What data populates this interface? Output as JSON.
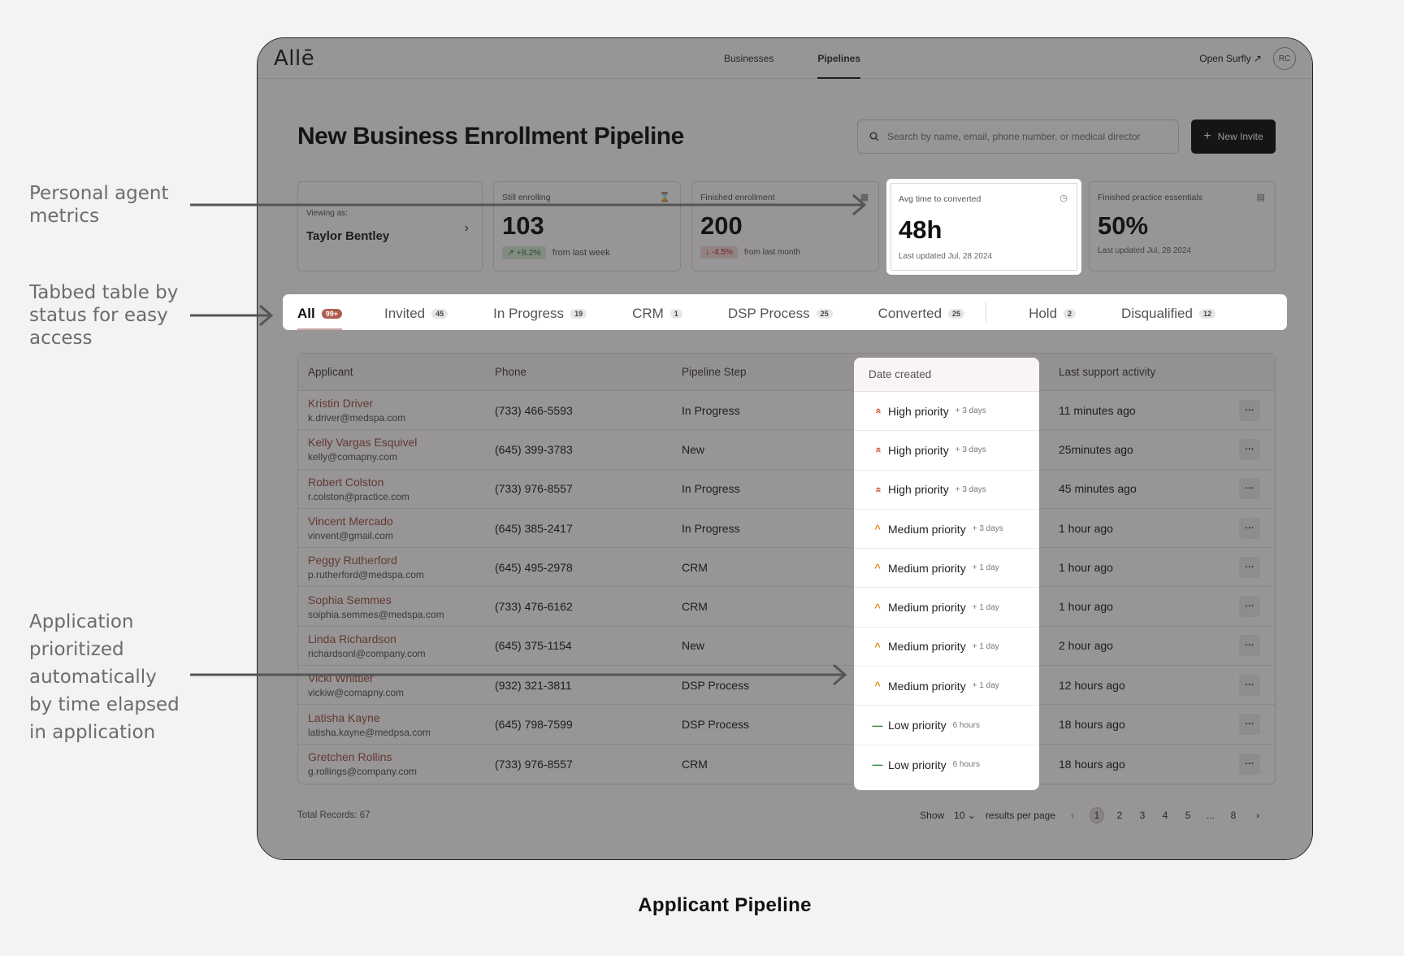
{
  "annotations": {
    "metrics": "Personal agent metrics",
    "tabs": "Tabbed table by status for easy access",
    "priority": "Application prioritized automatically by time elapsed in application"
  },
  "caption": "Applicant Pipeline",
  "app": {
    "logo": "Allē",
    "nav": [
      "Businesses",
      "Pipelines"
    ],
    "active_nav": "Pipelines",
    "open_surfly": "Open Surfly ↗",
    "avatar_initials": "RC"
  },
  "header": {
    "title": "New Business Enrollment Pipeline",
    "search_placeholder": "Search by name, email, phone number, or medical director",
    "new_invite_label": "New Invite"
  },
  "viewing": {
    "label": "Viewing as:",
    "name": "Taylor Bentley"
  },
  "metrics": [
    {
      "label": "Still enrolling",
      "value": "103",
      "change": "↗ +8.2%",
      "change_dir": "up",
      "foot": "from last week",
      "icon": "hourglass-icon"
    },
    {
      "label": "Finished enrollment",
      "value": "200",
      "change": "↓ -4.5%",
      "change_dir": "down",
      "foot": "from last month",
      "icon": "calendar-icon"
    },
    {
      "label": "Avg time to converted",
      "value": "48h",
      "foot": "Last updated Jul, 28 2024",
      "icon": "clock-icon"
    },
    {
      "label": "Finished practice essentials",
      "value": "50%",
      "foot": "Last updated Jul, 28 2024",
      "icon": "document-icon"
    }
  ],
  "tabs": [
    {
      "label": "All",
      "count": "99+"
    },
    {
      "label": "Invited",
      "count": "45"
    },
    {
      "label": "In Progress",
      "count": "19"
    },
    {
      "label": "CRM",
      "count": "1"
    },
    {
      "label": "DSP Process",
      "count": "25"
    },
    {
      "label": "Converted",
      "count": "25"
    },
    {
      "label": "Hold",
      "count": "2"
    },
    {
      "label": "Disqualified",
      "count": "12"
    }
  ],
  "table": {
    "columns": [
      "Applicant",
      "Phone",
      "Pipeline Step",
      "Date created",
      "Last support activity"
    ],
    "rows": [
      {
        "name": "Kristin Driver",
        "email": "k.driver@medspa.com",
        "phone": "(733) 466-5593",
        "step": "In Progress",
        "priority": "High priority",
        "level": "high",
        "elapsed": "+ 3 days",
        "activity": "11 minutes ago"
      },
      {
        "name": "Kelly Vargas Esquivel",
        "email": "kelly@comapny.com",
        "phone": "(645) 399-3783",
        "step": "New",
        "priority": "High priority",
        "level": "high",
        "elapsed": "+ 3 days",
        "activity": "25minutes ago"
      },
      {
        "name": "Robert Colston",
        "email": "r.colston@practice.com",
        "phone": "(733) 976-8557",
        "step": "In Progress",
        "priority": "High priority",
        "level": "high",
        "elapsed": "+ 3 days",
        "activity": "45 minutes ago"
      },
      {
        "name": "Vincent Mercado",
        "email": "vinvent@gmail.com",
        "phone": "(645) 385-2417",
        "step": "In Progress",
        "priority": "Medium priority",
        "level": "medium",
        "elapsed": "+ 3 days",
        "activity": "1 hour ago"
      },
      {
        "name": "Peggy Rutherford",
        "email": "p.rutherford@medspa.com",
        "phone": "(645) 495-2978",
        "step": "CRM",
        "priority": "Medium priority",
        "level": "medium",
        "elapsed": "+ 1 day",
        "activity": "1 hour ago"
      },
      {
        "name": "Sophia Semmes",
        "email": "soiphia.semmes@medspa.com",
        "phone": "(733) 476-6162",
        "step": "CRM",
        "priority": "Medium priority",
        "level": "medium",
        "elapsed": "+ 1 day",
        "activity": "1 hour ago"
      },
      {
        "name": "Linda Richardson",
        "email": "richardsonl@company.com",
        "phone": "(645) 375-1154",
        "step": "New",
        "priority": "Medium priority",
        "level": "medium",
        "elapsed": "+ 1 day",
        "activity": "2 hour ago"
      },
      {
        "name": "Vicki Whittier",
        "email": "vickiw@comapny.com",
        "phone": "(932) 321-3811",
        "step": "DSP Process",
        "priority": "Medium priority",
        "level": "medium",
        "elapsed": "+ 1 day",
        "activity": "12 hours ago"
      },
      {
        "name": "Latisha Kayne",
        "email": "latisha.kayne@medpsa.com",
        "phone": "(645) 798-7599",
        "step": "DSP Process",
        "priority": "Low priority",
        "level": "low",
        "elapsed": "6 hours",
        "activity": "18 hours ago"
      },
      {
        "name": "Gretchen Rollins",
        "email": "g.rollings@company.com",
        "phone": "(733) 976-8557",
        "step": "CRM",
        "priority": "Low priority",
        "level": "low",
        "elapsed": "6 hours",
        "activity": "18 hours ago"
      }
    ],
    "more_label": "···"
  },
  "footer": {
    "total": "Total Records: 67",
    "show_label": "Show",
    "per_page": "10",
    "per_page_suffix": "results per page",
    "pages": [
      "1",
      "2",
      "3",
      "4",
      "5",
      "...",
      "8"
    ],
    "active_page": "1"
  },
  "colors": {
    "accent": "#a0564c",
    "dim_overlay": "#1c1818",
    "high": "#d24a2a",
    "medium": "#e38b1a",
    "low": "#2f8a3a"
  }
}
